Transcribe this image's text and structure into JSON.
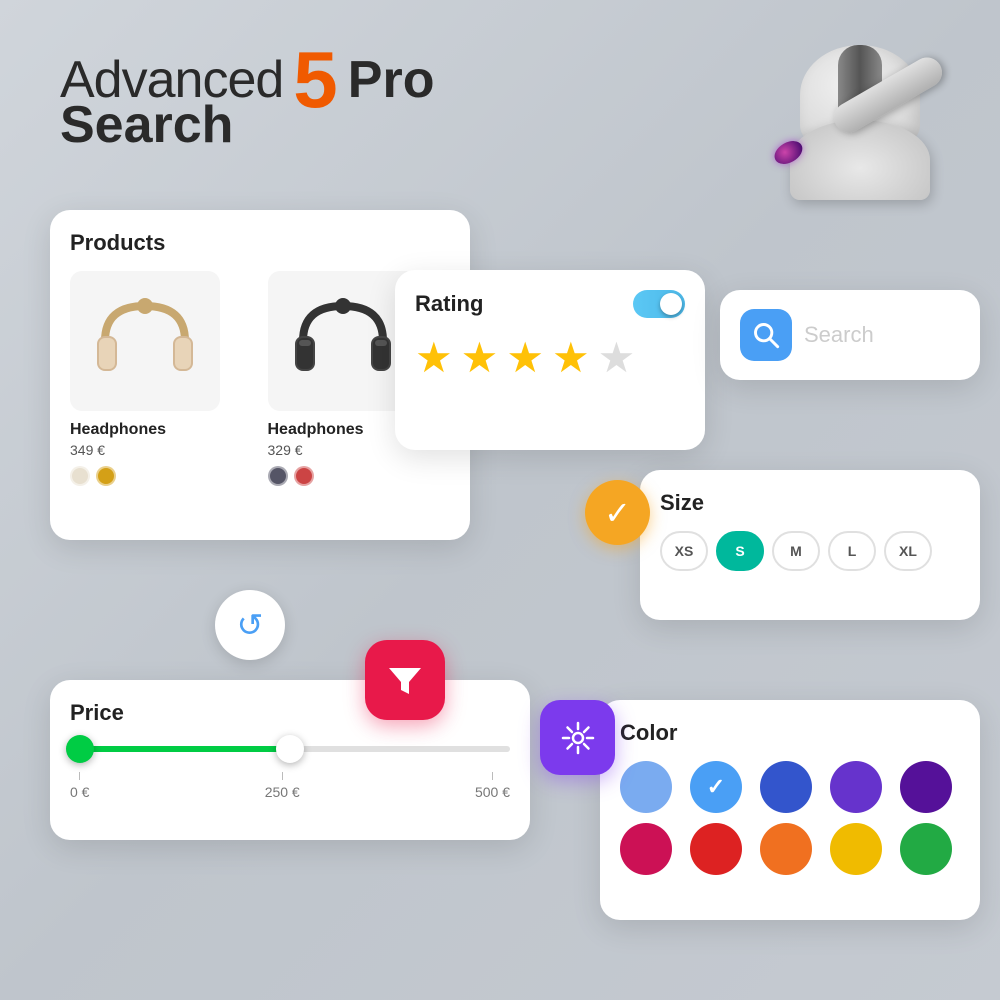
{
  "title": {
    "advanced": "Advanced",
    "number": "5",
    "pro": "Pro",
    "search": "Search"
  },
  "products_card": {
    "title": "Products",
    "product1": {
      "name": "Headphones",
      "price": "349 €",
      "colors": [
        "#e8e0d0",
        "#d4a017"
      ]
    },
    "product2": {
      "name": "Headphones",
      "price": "329 €",
      "colors": [
        "#555566",
        "#cc4444"
      ]
    }
  },
  "rating_card": {
    "title": "Rating",
    "stars_filled": 4,
    "stars_total": 5,
    "toggle_on": true
  },
  "search_bar": {
    "placeholder": "Search"
  },
  "size_card": {
    "title": "Size",
    "options": [
      "XS",
      "S",
      "M",
      "L",
      "XL"
    ],
    "active": "S"
  },
  "price_card": {
    "title": "Price",
    "min": "0 €",
    "mid": "250 €",
    "max": "500 €",
    "current_value": "250 €"
  },
  "color_card": {
    "title": "Color",
    "colors_row1": [
      {
        "hex": "#7aabf0",
        "selected": false
      },
      {
        "hex": "#4a9ff5",
        "selected": true
      },
      {
        "hex": "#3355cc",
        "selected": false
      },
      {
        "hex": "#6633cc",
        "selected": false
      },
      {
        "hex": "#551199",
        "selected": false
      }
    ],
    "colors_row2": [
      {
        "hex": "#cc1155",
        "selected": false
      },
      {
        "hex": "#dd2222",
        "selected": false
      },
      {
        "hex": "#f07020",
        "selected": false
      },
      {
        "hex": "#f0bb00",
        "selected": false
      },
      {
        "hex": "#22aa44",
        "selected": false
      }
    ]
  },
  "buttons": {
    "reset": "↺",
    "filter": "⧩",
    "check": "✓",
    "settings": "⚙"
  }
}
